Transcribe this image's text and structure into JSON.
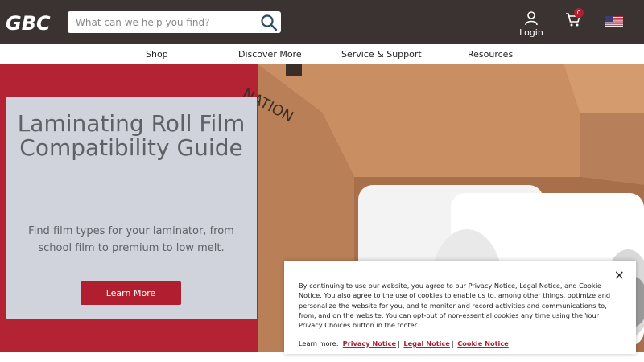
{
  "brand": {
    "logo_text": "GBC"
  },
  "search": {
    "placeholder": "What can we help you find?"
  },
  "account": {
    "login_label": "Login"
  },
  "cart": {
    "count": "0"
  },
  "nav": {
    "items": [
      "Shop",
      "Discover More",
      "Service & Support",
      "Resources"
    ]
  },
  "hero": {
    "box_text": "NATION",
    "title": "Laminating Roll Film Compatibility Guide",
    "subtitle": "Find film types for your laminator, from school film to premium to low melt.",
    "button_label": "Learn More"
  },
  "cookie_banner": {
    "close_symbol": "×",
    "body": "By continuing to use our website, you agree to our Privacy Notice, Legal Notice, and Cookie Notice. You also agree to the use of cookies to enable us to, among other things, optimize and personalize the website for you, and to monitor and record activities and communications to, from, and on the website. You can opt-out of non-essential cookies any time using the Your Privacy Choices button in the footer.",
    "learn_more_label": "Learn more:",
    "links": [
      "Privacy Notice",
      "Legal Notice",
      "Cookie Notice"
    ],
    "separator": "|"
  },
  "colors": {
    "header_bg": "#3a3331",
    "accent_red": "#b01e2f",
    "hero_card_bg": "#d0d2dc"
  }
}
